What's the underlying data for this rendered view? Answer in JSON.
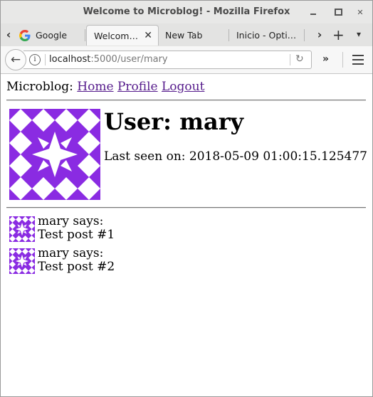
{
  "window": {
    "title": "Welcome to Microblog! - Mozilla Firefox"
  },
  "tabs": [
    {
      "label": "Google",
      "favicon": "google-icon"
    },
    {
      "label": "Welcom…",
      "active": true
    },
    {
      "label": "New Tab"
    },
    {
      "label": "Inicio - Opti…"
    }
  ],
  "url": {
    "host": "localhost",
    "rest": ":5000/user/mary"
  },
  "page": {
    "brand": "Microblog:",
    "nav": [
      "Home",
      "Profile",
      "Logout"
    ],
    "user_heading": "User: mary",
    "last_seen": "Last seen on: 2018-05-09 01:00:15.125477",
    "avatar_color": "#8a2be2",
    "posts": [
      {
        "author_line": "mary says:",
        "body": "Test post #1"
      },
      {
        "author_line": "mary says:",
        "body": "Test post #2"
      }
    ]
  }
}
